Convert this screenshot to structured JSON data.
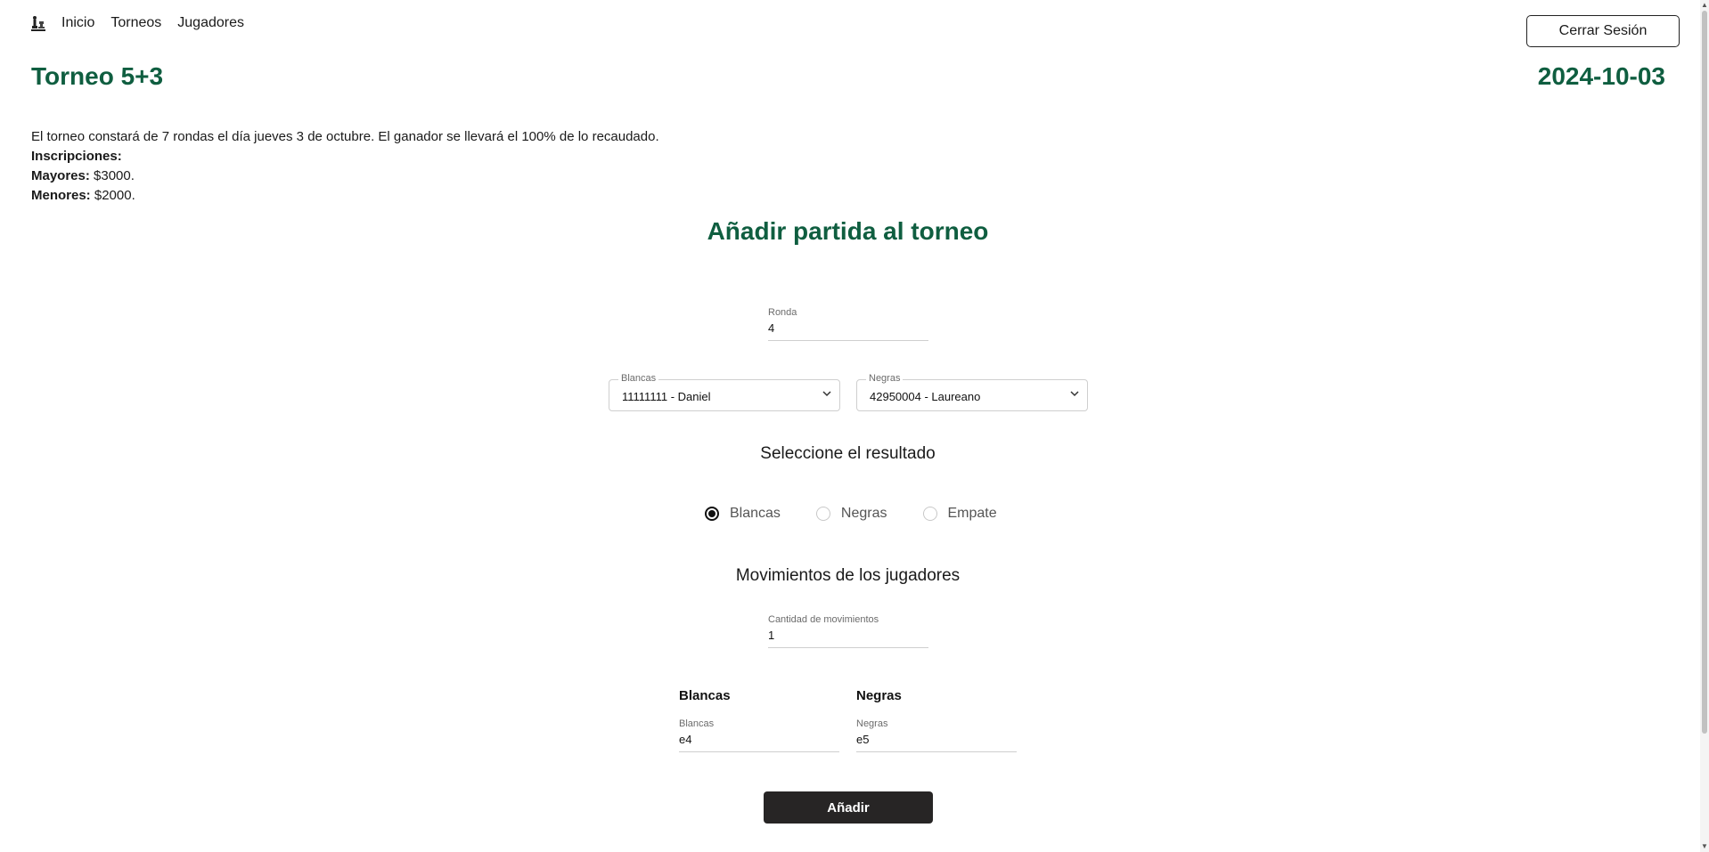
{
  "nav": {
    "logo_icon": "chess-pieces-icon",
    "links": [
      "Inicio",
      "Torneos",
      "Jugadores"
    ],
    "logout_label": "Cerrar Sesión"
  },
  "tournament": {
    "title": "Torneo 5+3",
    "date": "2024-10-03",
    "description": "El torneo constará de 7 rondas el día jueves 3 de octubre. El ganador se llevará el 100% de lo recaudado.",
    "inscriptions_label": "Inscripciones:",
    "adults_label": "Mayores:",
    "adults_value": " $3000.",
    "minors_label": "Menores:",
    "minors_value": " $2000."
  },
  "form": {
    "title": "Añadir partida al torneo",
    "round_label": "Ronda",
    "round_value": "4",
    "white_select_label": "Blancas",
    "white_select_value": "11111111 - Daniel",
    "black_select_label": "Negras",
    "black_select_value": "42950004 - Laureano",
    "result_heading": "Seleccione el resultado",
    "result_options": [
      "Blancas",
      "Negras",
      "Empate"
    ],
    "result_selected": "Blancas",
    "moves_heading": "Movimientos de los jugadores",
    "moves_count_label": "Cantidad de movimientos",
    "moves_count_value": "1",
    "white_col_heading": "Blancas",
    "black_col_heading": "Negras",
    "white_move_label": "Blancas",
    "white_move_value": "e4",
    "black_move_label": "Negras",
    "black_move_value": "e5",
    "submit_label": "Añadir"
  }
}
